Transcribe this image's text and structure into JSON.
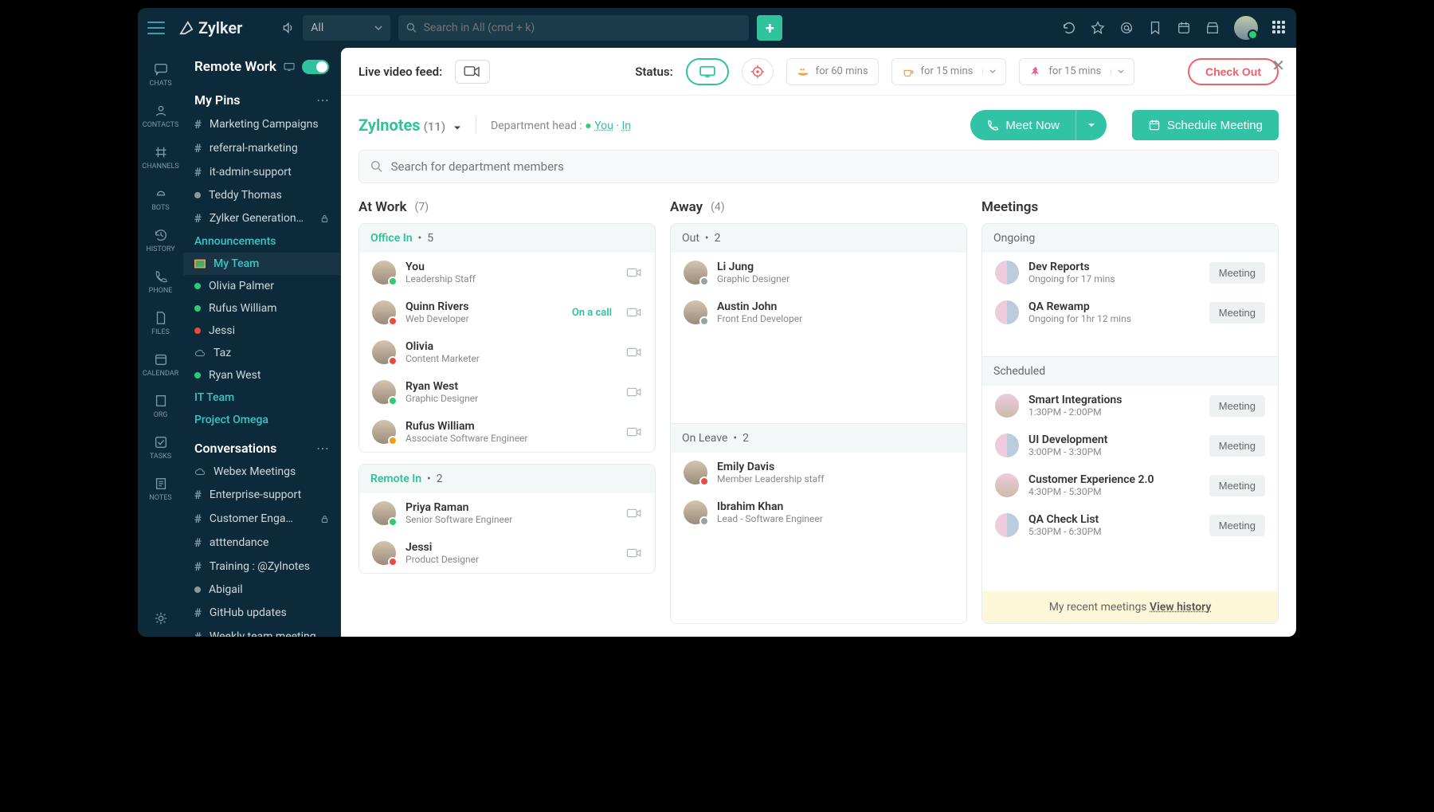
{
  "brand": "Zylker",
  "top_search": {
    "category": "All",
    "placeholder": "Search in All (cmd + k)"
  },
  "rail": [
    "CHATS",
    "CONTACTS",
    "CHANNELS",
    "BOTS",
    "HISTORY",
    "PHONE",
    "FILES",
    "CALENDAR",
    "ORG",
    "TASKS",
    "NOTES"
  ],
  "remote_work_title": "Remote Work",
  "pins_title": "My Pins",
  "pins": [
    {
      "type": "hash",
      "label": "Marketing Campaigns"
    },
    {
      "type": "hash",
      "label": "referral-marketing"
    },
    {
      "type": "hash",
      "label": "it-admin-support"
    },
    {
      "type": "dot",
      "color": "#8a98a0",
      "label": "Teddy Thomas"
    },
    {
      "type": "hash",
      "label": "Zylker Generation…",
      "lock": true
    }
  ],
  "announcements": "Announcements",
  "my_team": "My Team",
  "team_people": [
    {
      "label": "Olivia Palmer",
      "color": "#2ecc71"
    },
    {
      "label": "Rufus William",
      "color": "#2ecc71"
    },
    {
      "label": "Jessi",
      "color": "#e74c3c"
    },
    {
      "label": "Taz",
      "type": "cloud"
    },
    {
      "label": "Ryan West",
      "color": "#2ecc71"
    }
  ],
  "it_team": "IT Team",
  "project_omega": "Project Omega",
  "conversations_title": "Conversations",
  "conversations": [
    {
      "type": "cloud",
      "label": "Webex Meetings"
    },
    {
      "type": "hash",
      "label": "Enterprise-support"
    },
    {
      "type": "hash",
      "label": "Customer Enga…",
      "lock": true
    },
    {
      "type": "hash",
      "label": "atttendance"
    },
    {
      "type": "hash",
      "label": "Training : @Zylnotes"
    },
    {
      "type": "dot",
      "color": "#8a98a0",
      "label": "Abigail"
    },
    {
      "type": "hash",
      "label": "GitHub updates"
    },
    {
      "type": "hash",
      "label": "Weekly team meeting"
    }
  ],
  "statusbar": {
    "live_feed": "Live video feed:",
    "status": "Status:",
    "durations": [
      "for 60 mins",
      "for 15 mins",
      "for 15 mins"
    ],
    "checkout": "Check Out"
  },
  "dept": {
    "name": "Zylnotes",
    "count": "(11)",
    "head_label": "Department head : ",
    "you": "You",
    "sep": " · ",
    "in": "In"
  },
  "meet_now": "Meet Now",
  "schedule": "Schedule Meeting",
  "member_search": "Search for department members",
  "cols": {
    "work": {
      "title": "At Work",
      "count": "(7)"
    },
    "away": {
      "title": "Away",
      "count": "(4)"
    },
    "meetings": {
      "title": "Meetings"
    }
  },
  "office_in": {
    "label": "Office In",
    "count": "5"
  },
  "remote_in": {
    "label": "Remote In",
    "count": "2"
  },
  "out": {
    "label": "Out",
    "count": "2"
  },
  "on_leave": {
    "label": "On Leave",
    "count": "2"
  },
  "ongoing": "Ongoing",
  "scheduled": "Scheduled",
  "work_office": [
    {
      "name": "You",
      "role": "Leadership Staff",
      "badge": "g"
    },
    {
      "name": "Quinn Rivers",
      "role": "Web Developer",
      "badge": "r",
      "oncall": "On a call"
    },
    {
      "name": "Olivia",
      "role": "Content Marketer",
      "badge": "r"
    },
    {
      "name": "Ryan West",
      "role": "Graphic Designer",
      "badge": "g"
    },
    {
      "name": "Rufus William",
      "role": "Associate Software Engineer",
      "badge": "o"
    }
  ],
  "work_remote": [
    {
      "name": "Priya Raman",
      "role": "Senior Software Engineer",
      "badge": "g"
    },
    {
      "name": "Jessi",
      "role": "Product Designer",
      "badge": "r"
    }
  ],
  "away_out": [
    {
      "name": "Li Jung",
      "role": "Graphic Designer",
      "badge": "gr"
    },
    {
      "name": "Austin John",
      "role": "Front End Developer",
      "badge": "gr"
    }
  ],
  "away_leave": [
    {
      "name": "Emily Davis",
      "role": "Member Leadership staff",
      "badge": "r"
    },
    {
      "name": "Ibrahim Khan",
      "role": "Lead - Software Engineer",
      "badge": "gr"
    }
  ],
  "ongoing_meetings": [
    {
      "name": "Dev Reports",
      "time": "Ongoing for 17 mins",
      "btn": "Meeting"
    },
    {
      "name": "QA Rewamp",
      "time": "Ongoing for 1hr 12 mins",
      "btn": "Meeting"
    }
  ],
  "scheduled_meetings": [
    {
      "name": "Smart Integrations",
      "time": "1:30PM - 2:00PM",
      "btn": "Meeting"
    },
    {
      "name": "UI Development",
      "time": "3:00PM - 3:30PM",
      "btn": "Meeting"
    },
    {
      "name": "Customer Experience 2.0",
      "time": "4:30PM - 5:30PM",
      "btn": "Meeting"
    },
    {
      "name": "QA Check List",
      "time": "5:30PM - 6:30PM",
      "btn": "Meeting"
    }
  ],
  "recent": {
    "label": "My recent meetings  ",
    "link": "View history"
  },
  "colors": {
    "green": "#2ecc71",
    "red": "#e74c3c",
    "orange": "#f39c12",
    "grey": "#8a98a0"
  }
}
